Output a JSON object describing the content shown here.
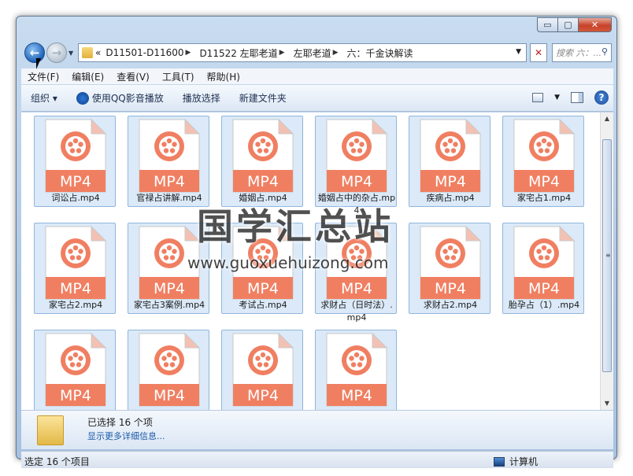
{
  "window": {
    "min_label": "▭",
    "max_label": "▢",
    "close_label": "✕"
  },
  "nav": {
    "address_overflow": "«",
    "breadcrumb": [
      "D11501-D11600",
      "D11522 左耶老道",
      "左耶老道",
      "六：千金诀解读"
    ],
    "search_placeholder": "搜索 六：...",
    "refresh_glyph": "✕",
    "search_glyph": "⚲"
  },
  "menu": [
    "文件(F)",
    "编辑(E)",
    "查看(V)",
    "工具(T)",
    "帮助(H)"
  ],
  "commands": {
    "organize": "组织 ▾",
    "play_qq": "使用QQ影音播放",
    "play_select": "播放选择",
    "new_folder": "新建文件夹",
    "help": "?"
  },
  "files": [
    {
      "name": "词讼占.mp4",
      "badge": "MP4"
    },
    {
      "name": "官禄占讲解.mp4",
      "badge": "MP4"
    },
    {
      "name": "婚姻占.mp4",
      "badge": "MP4"
    },
    {
      "name": "婚姻占中的杂占.mp4",
      "badge": "MP4"
    },
    {
      "name": "疾病占.mp4",
      "badge": "MP4"
    },
    {
      "name": "家宅占1.mp4",
      "badge": "MP4"
    },
    {
      "name": "家宅占2.mp4",
      "badge": "MP4"
    },
    {
      "name": "家宅占3案例.mp4",
      "badge": "MP4"
    },
    {
      "name": "考试占.mp4",
      "badge": "MP4"
    },
    {
      "name": "求财占（日时法）.mp4",
      "badge": "MP4"
    },
    {
      "name": "求财占2.mp4",
      "badge": "MP4"
    },
    {
      "name": "胎孕占（1）.mp4",
      "badge": "MP4"
    },
    {
      "name": "",
      "badge": "MP4"
    },
    {
      "name": "",
      "badge": "MP4"
    },
    {
      "name": "",
      "badge": "MP4"
    },
    {
      "name": "",
      "badge": "MP4"
    }
  ],
  "details": {
    "selected": "已选择 16 个项",
    "more": "显示更多详细信息..."
  },
  "status": {
    "left": "选定 16 个项目",
    "right": "计算机"
  },
  "watermark": {
    "title": "国学汇总站",
    "url": "www.guoxuehuizong.com"
  },
  "colors": {
    "file_accent": "#f07f62",
    "tile_selected": "#dbe9f8"
  }
}
